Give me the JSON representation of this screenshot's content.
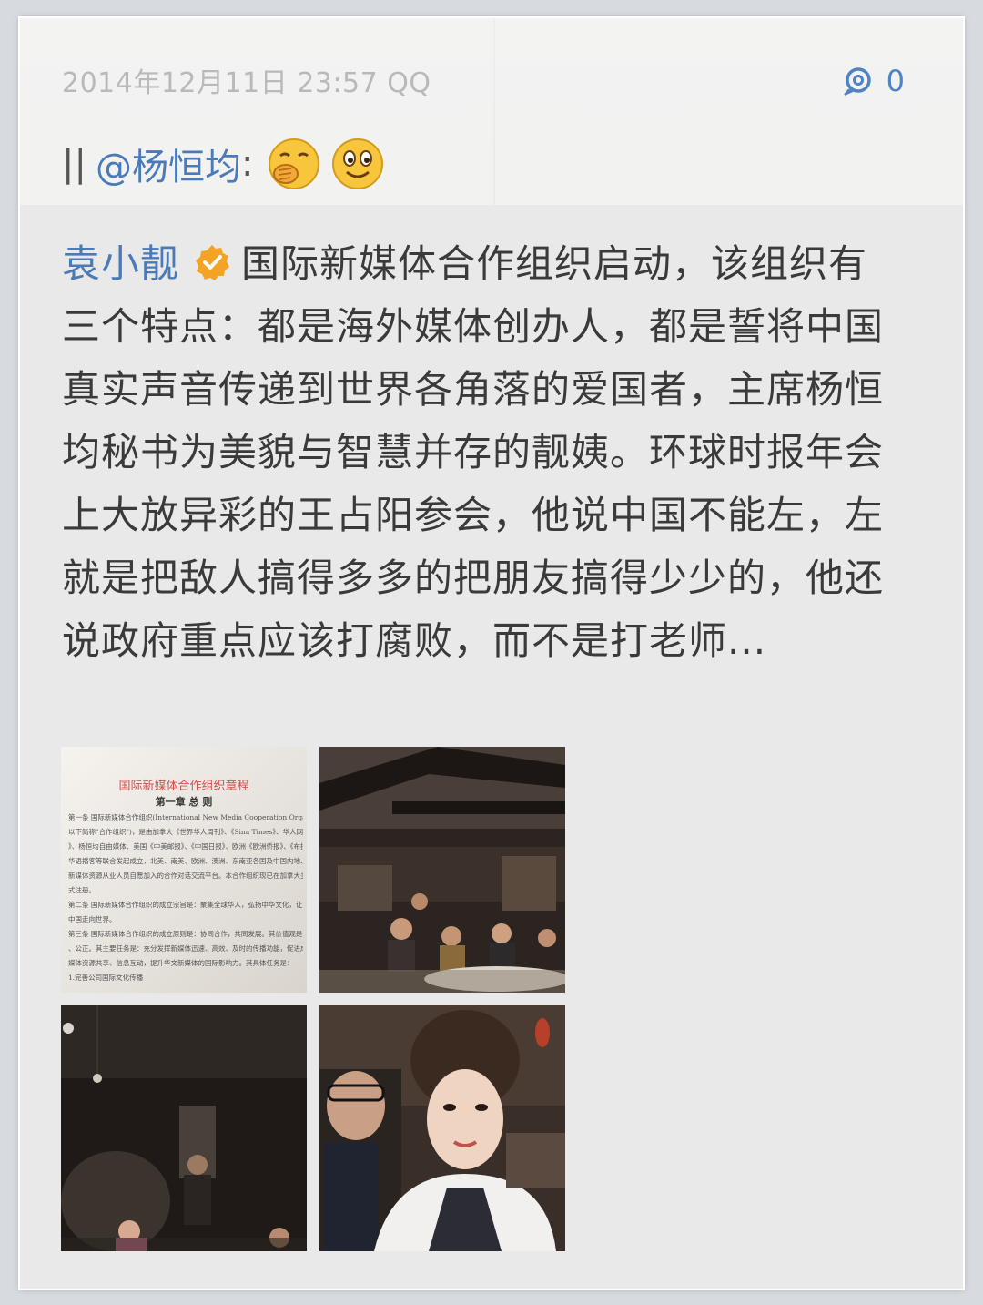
{
  "header": {
    "timestamp": "2014年12月11日 23:57 QQ",
    "comment_count": "0",
    "comment_icon": "comment-icon"
  },
  "repost": {
    "separator": "||",
    "mention": "@杨恒均",
    "colon": ":",
    "emojis": [
      "cover-mouth-emoji",
      "smile-emoji"
    ]
  },
  "quoted_post": {
    "author": "袁小靓",
    "badge_icon": "verified-badge-icon",
    "text": "国际新媒体合作组织启动，该组织有三个特点：都是海外媒体创办人，都是誓将中国真实声音传递到世界各角落的爱国者，主席杨恒均秘书为美貌与智慧并存的靓姨。环球时报年会上大放异彩的王占阳参会，他说中国不能左，左就是把敌人搞得多多的把朋友搞得少少的，他还说政府重点应该打腐败，而不是打老师..."
  },
  "photos": {
    "doc_title": "国际新媒体合作组织章程",
    "doc_chapter": "第一章 总 则",
    "doc_lines": [
      "第一条  国际新媒体合作组织(International New Media Cooperation Organiz",
      "以下简称\"合作组织\")，是由加拿大《世界华人周刊》、《Sina Times》、华人网络电视台",
      "》、杨恒均自由媒体、美国《中美邮报》、《中国日报》、欧洲《欧洲侨报》、《布拉格时",
      "华语播客等联合发起成立，北美、南美、欧洲、澳洲、东南亚各国及中国内地、港澳台各华",
      "新媒体资源从业人员自愿加入的合作对话交流平台。本合作组织现已在加拿大多伦多政府和",
      "式注册。",
      "    第二条  国际新媒体合作组织的成立宗旨是：聚集全球华人，弘扬中华文化，让世界了",
      "中国走向世界。",
      "    第三条  国际新媒体合作组织的成立原则是：协同合作，共同发展。其价值观是：平",
      "、公正。其主要任务是：充分发挥新媒体迅速、高效、及时的传播功能，促进成员单位",
      "媒体资源共享、信息互动，提升华文新媒体的国际影响力。其具体任务是：",
      "    1.完善公司国际文化传播"
    ],
    "items": [
      "document-photo",
      "banquet-photo",
      "speaker-photo",
      "selfie-photo"
    ]
  }
}
